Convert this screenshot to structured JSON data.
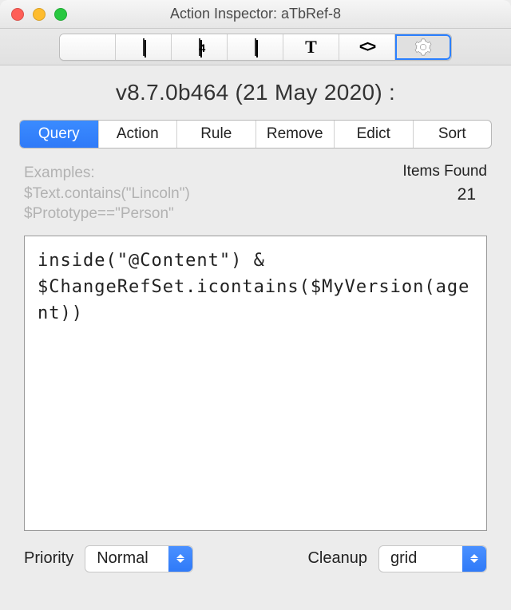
{
  "window": {
    "title": "Action Inspector: aTbRef-8"
  },
  "toolbar_icons": [
    {
      "name": "drawer-icon"
    },
    {
      "name": "page-icon"
    },
    {
      "name": "four-page-icon"
    },
    {
      "name": "gradient-square-icon"
    },
    {
      "name": "text-T-icon"
    },
    {
      "name": "code-icon"
    },
    {
      "name": "gear-icon",
      "selected": true
    }
  ],
  "subtitle": "v8.7.0b464 (21 May 2020)  :",
  "tabs": [
    "Query",
    "Action",
    "Rule",
    "Remove",
    "Edict",
    "Sort"
  ],
  "active_tab": "Query",
  "examples": {
    "label": "Examples:",
    "line1": "$Text.contains(\"Lincoln\")",
    "line2": "$Prototype==\"Person\""
  },
  "found": {
    "label": "Items Found",
    "count": "21"
  },
  "query_text": "inside(\"@Content\") & $ChangeRefSet.icontains($MyVersion(agent))",
  "priority": {
    "label": "Priority",
    "value": "Normal"
  },
  "cleanup": {
    "label": "Cleanup",
    "value": "grid"
  },
  "colors": {
    "accent": "#2f7af8"
  }
}
